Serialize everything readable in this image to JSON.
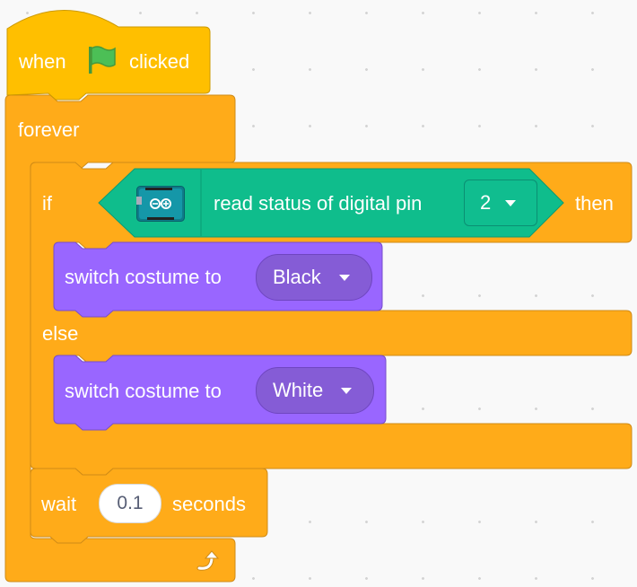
{
  "workspace": {
    "colors": {
      "events": "#ffbf00",
      "control": "#ffab19",
      "looks": "#9966ff",
      "arduino": "#0fbd8c",
      "flag": "#4cbf56"
    }
  },
  "script": {
    "hat": {
      "when": "when",
      "flag_icon": "green-flag-icon",
      "clicked": "clicked"
    },
    "forever": {
      "label": "forever",
      "loop_icon": "rotate-arrow-icon"
    },
    "if_else": {
      "if_label": "if",
      "then_label": "then",
      "else_label": "else",
      "condition": {
        "icon": "arduino-board-icon",
        "text": "read status of digital pin",
        "pin_value": "2"
      }
    },
    "if_branch": {
      "label": "switch costume to",
      "costume": "Black"
    },
    "else_branch": {
      "label": "switch costume to",
      "costume": "White"
    },
    "wait": {
      "label": "wait",
      "value": "0.1",
      "unit": "seconds"
    }
  }
}
